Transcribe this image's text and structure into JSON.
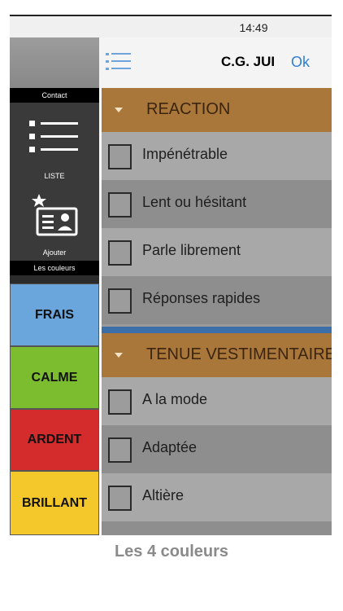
{
  "status_bar": {
    "time": "14:49"
  },
  "header": {
    "title": "C.G. JUI",
    "ok_label": "Ok"
  },
  "sidebar": {
    "contact_caption": "Contact",
    "list_label": "LISTE",
    "add_label": "Ajouter",
    "colors_caption": "Les couleurs",
    "color_buttons": [
      {
        "label": "FRAIS",
        "color": "#6aa5dc"
      },
      {
        "label": "CALME",
        "color": "#7cbc2f"
      },
      {
        "label": "ARDENT",
        "color": "#d42c2c"
      },
      {
        "label": "BRILLANT",
        "color": "#f4c82a"
      }
    ]
  },
  "sections": [
    {
      "title": "REACTION",
      "items": [
        "Impénétrable",
        "Lent ou hésitant",
        "Parle librement",
        "Réponses rapides"
      ]
    },
    {
      "title": "TENUE VESTIMENTAIRE",
      "items": [
        "A la mode",
        "Adaptée",
        "Altière"
      ]
    }
  ],
  "footer": {
    "caption": "Les 4 couleurs"
  },
  "colors": {
    "section_header": "#a9773a",
    "accent": "#2f7fd4",
    "separator": "#3c6ea7"
  }
}
